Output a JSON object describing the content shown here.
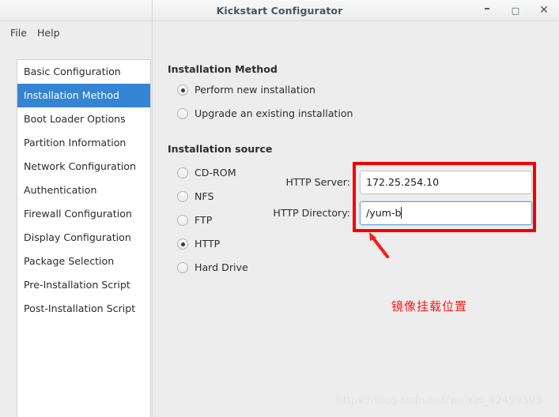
{
  "window": {
    "title": "Kickstart Configurator",
    "controls": {
      "minimize": "–",
      "maximize": "□",
      "close": "✕"
    }
  },
  "menubar": {
    "items": [
      {
        "label": "File"
      },
      {
        "label": "Help"
      }
    ]
  },
  "sidebar": {
    "items": [
      {
        "label": "Basic Configuration",
        "selected": false
      },
      {
        "label": "Installation Method",
        "selected": true
      },
      {
        "label": "Boot Loader Options",
        "selected": false
      },
      {
        "label": "Partition Information",
        "selected": false
      },
      {
        "label": "Network Configuration",
        "selected": false
      },
      {
        "label": "Authentication",
        "selected": false
      },
      {
        "label": "Firewall Configuration",
        "selected": false
      },
      {
        "label": "Display Configuration",
        "selected": false
      },
      {
        "label": "Package Selection",
        "selected": false
      },
      {
        "label": "Pre-Installation Script",
        "selected": false
      },
      {
        "label": "Post-Installation Script",
        "selected": false
      }
    ],
    "selected_color": "#3584d4"
  },
  "main": {
    "installation_method": {
      "heading": "Installation Method",
      "options": [
        {
          "label": "Perform new installation",
          "selected": true
        },
        {
          "label": "Upgrade an existing installation",
          "selected": false
        }
      ]
    },
    "installation_source": {
      "heading": "Installation source",
      "options": [
        {
          "label": "CD-ROM",
          "selected": false
        },
        {
          "label": "NFS",
          "selected": false
        },
        {
          "label": "FTP",
          "selected": false
        },
        {
          "label": "HTTP",
          "selected": true
        },
        {
          "label": "Hard Drive",
          "selected": false
        }
      ],
      "fields": [
        {
          "label": "HTTP Server:",
          "value": "172.25.254.10",
          "focused": false
        },
        {
          "label": "HTTP Directory:",
          "value": "/yum-b",
          "focused": true
        }
      ]
    }
  },
  "annotation": {
    "note_text": "镜像挂载位置",
    "highlight_color": "#f50000",
    "note_color": "#fb1a1a"
  },
  "watermark": {
    "text": "https://blog.csdn.net/weixin_42499593"
  }
}
